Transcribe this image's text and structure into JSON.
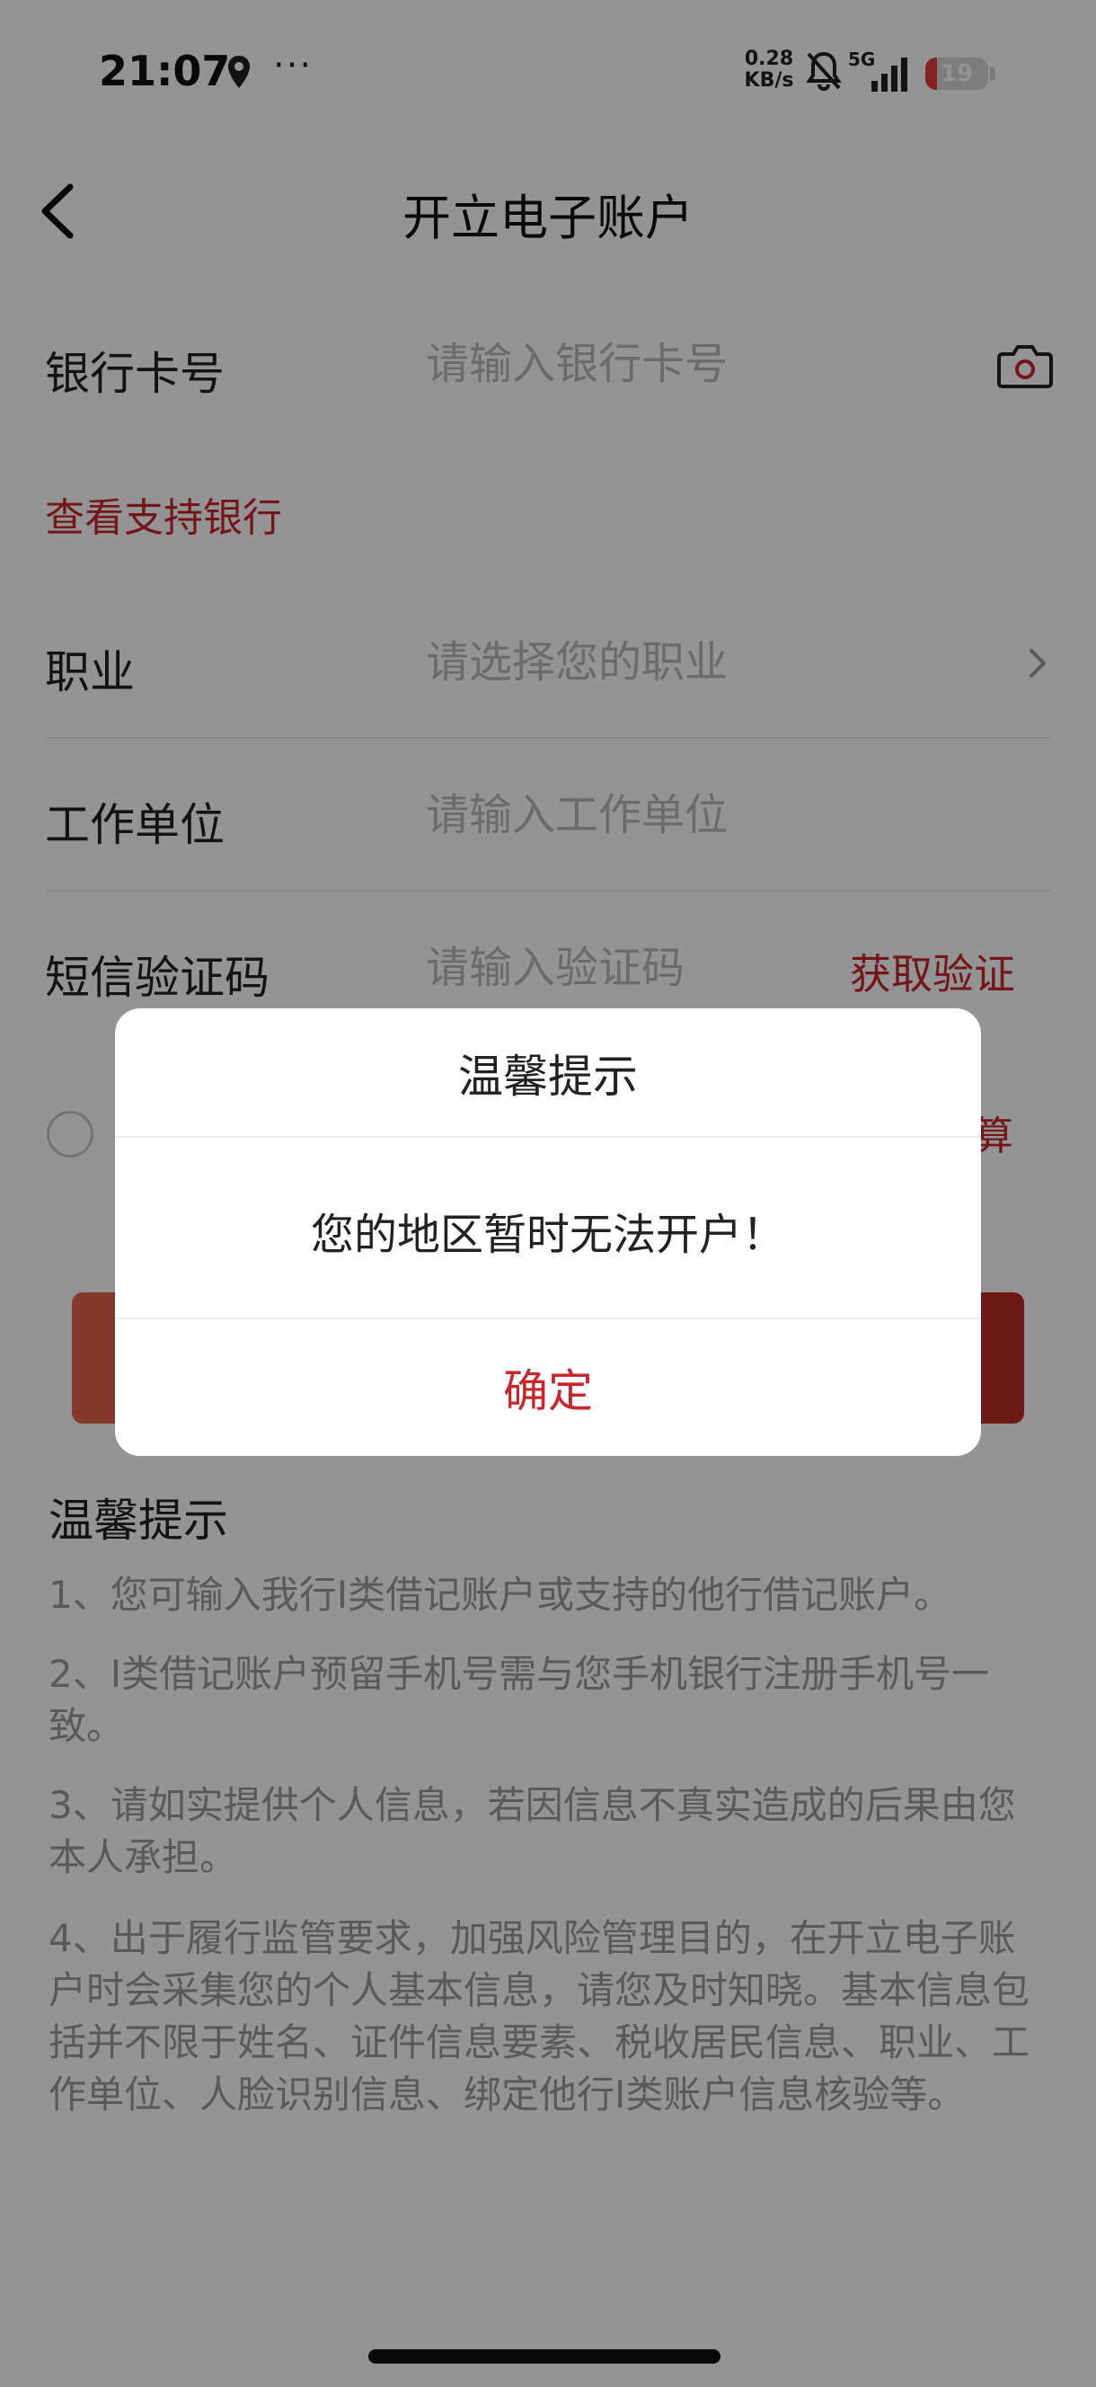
{
  "status_bar": {
    "time": "21:07",
    "dots": "···",
    "speed_value": "0.28",
    "speed_unit": "KB/s",
    "network": "5G",
    "battery": "19"
  },
  "nav": {
    "title": "开立电子账户"
  },
  "form": {
    "card": {
      "label": "银行卡号",
      "placeholder": "请输入银行卡号"
    },
    "support_link": "查看支持银行",
    "job": {
      "label": "职业",
      "placeholder": "请选择您的职业"
    },
    "employer": {
      "label": "工作单位",
      "placeholder": "请输入工作单位"
    },
    "sms": {
      "label": "短信验证码",
      "placeholder": "请输入验证码",
      "get_code": "获取验证码"
    }
  },
  "agreement": {
    "visible_text": "算"
  },
  "tips": {
    "title": "温馨提示",
    "items": [
      "1、您可输入我行I类借记账户或支持的他行借记账户。",
      "2、I类借记账户预留手机号需与您手机银行注册手机号一致。",
      "3、请如实提供个人信息，若因信息不真实造成的后果由您本人承担。",
      "4、出于履行监管要求，加强风险管理目的，在开立电子账户时会采集您的个人基本信息，请您及时知晓。基本信息包括并不限于姓名、证件信息要素、税收居民信息、职业、工作单位、人脸识别信息、绑定他行I类账户信息核验等。"
    ]
  },
  "dialog": {
    "title": "温馨提示",
    "message": "您的地区暂时无法开户！",
    "ok_label": "确定"
  },
  "colors": {
    "accent": "#c8262b",
    "placeholder": "#b8b8b8",
    "tip_text": "#9a9a9a"
  }
}
